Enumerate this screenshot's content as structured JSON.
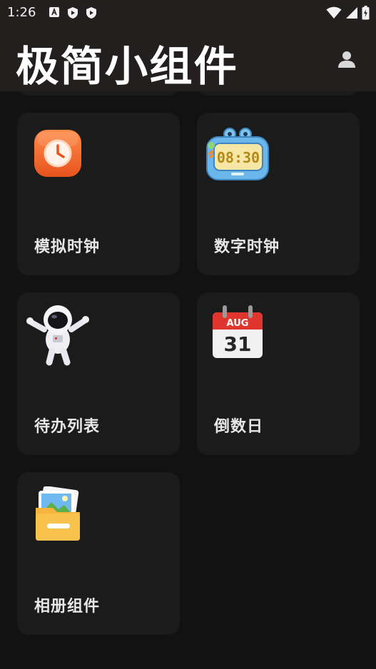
{
  "status_bar": {
    "time": "1:26",
    "icons": [
      "font-icon",
      "shield-play-icon",
      "shield-play-icon",
      "wifi-icon",
      "signal-icon",
      "battery-icon"
    ]
  },
  "header": {
    "title": "极简小组件",
    "profile_icon": "person-icon"
  },
  "widgets": [
    {
      "label": "模拟时钟",
      "icon": "analog-clock-icon"
    },
    {
      "label": "数字时钟",
      "icon": "digital-clock-icon"
    },
    {
      "label": "待办列表",
      "icon": "astronaut-icon"
    },
    {
      "label": "倒数日",
      "icon": "calendar-icon",
      "calendar_month": "AUG",
      "calendar_day": "31",
      "clock_text": "08:30"
    },
    {
      "label": "相册组件",
      "icon": "photo-folder-icon"
    }
  ],
  "colors": {
    "background": "#131212",
    "header": "#221f1e",
    "card": "#1c1b1b",
    "text": "#e7e7e7"
  }
}
